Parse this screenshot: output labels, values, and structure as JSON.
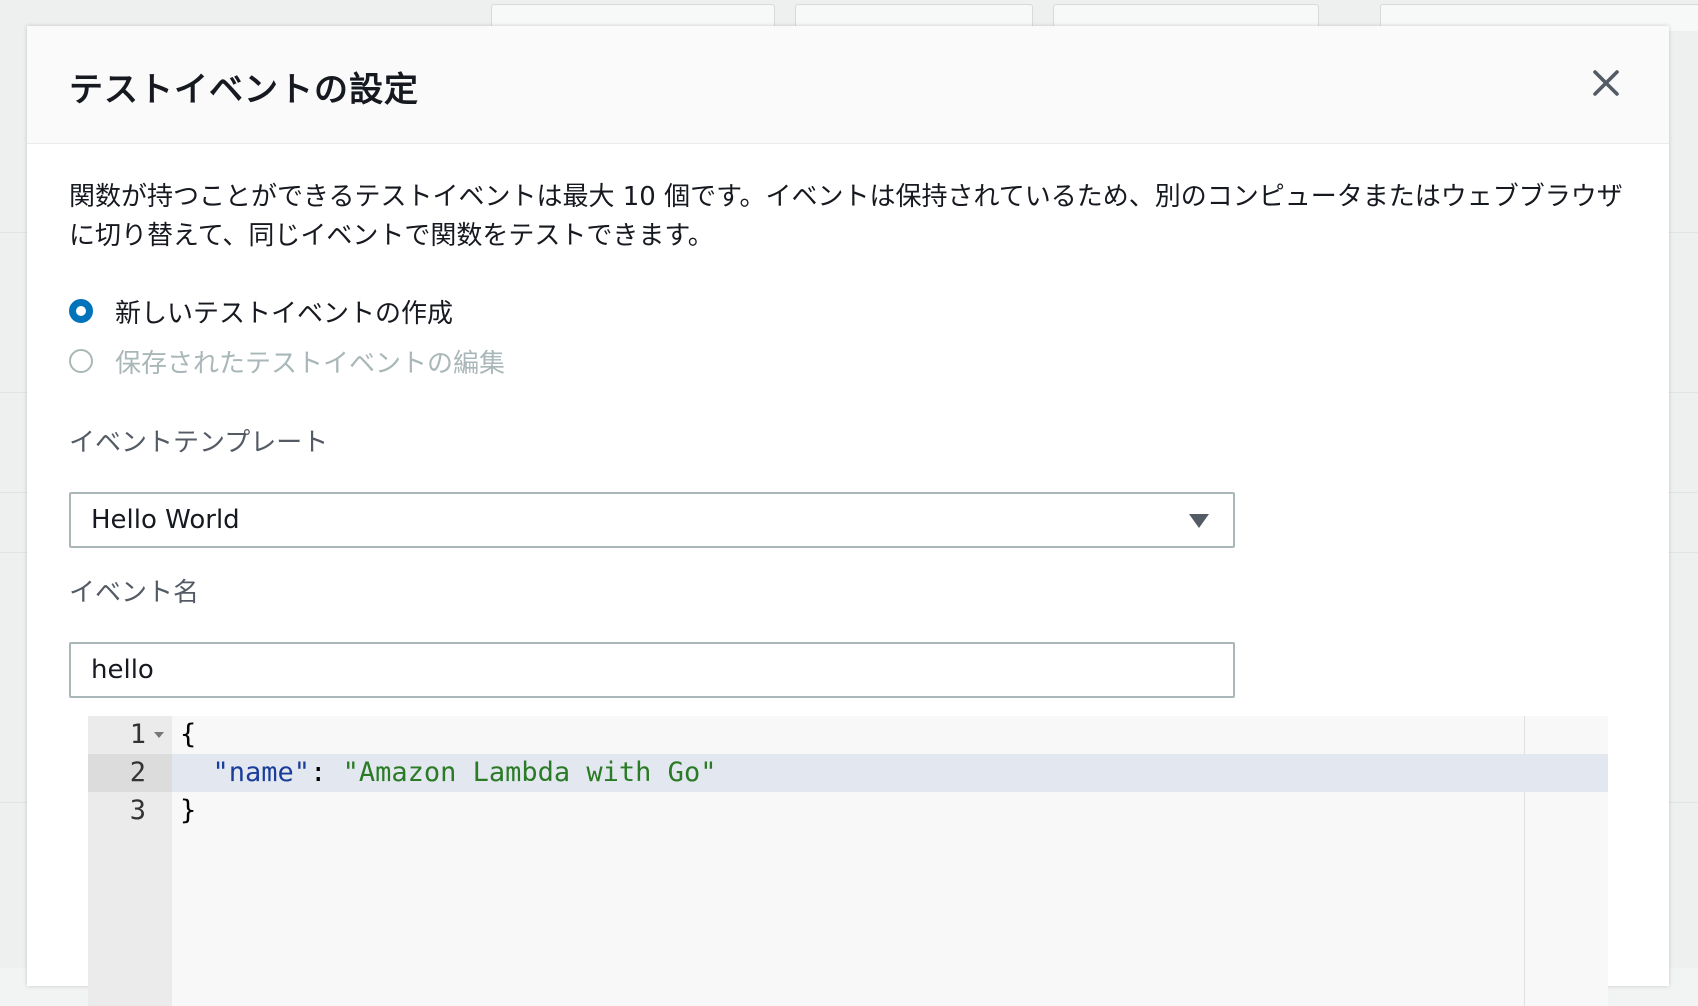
{
  "modal": {
    "title": "テストイベントの設定",
    "description": "関数が持つことができるテストイベントは最大 10 個です。イベントは保持されているため、別のコンピュータまたはウェブブラウザに切り替えて、同じイベントで関数をテストできます。",
    "options": {
      "create_new": "新しいテストイベントの作成",
      "edit_saved": "保存されたテストイベントの編集"
    },
    "template": {
      "label": "イベントテンプレート",
      "value": "Hello World"
    },
    "event_name": {
      "label": "イベント名",
      "value": "hello"
    },
    "editor": {
      "line_numbers": [
        "1",
        "2",
        "3"
      ],
      "line1": "{",
      "line2_indent": "  ",
      "line2_key": "\"name\"",
      "line2_colon": ": ",
      "line2_value": "\"Amazon Lambda with Go\"",
      "line3": "}",
      "active_line": 2
    }
  },
  "colors": {
    "accent": "#0073bb",
    "disabled": "#aab7b8",
    "json_key": "#1a3d9c",
    "json_string": "#2a7a26"
  }
}
